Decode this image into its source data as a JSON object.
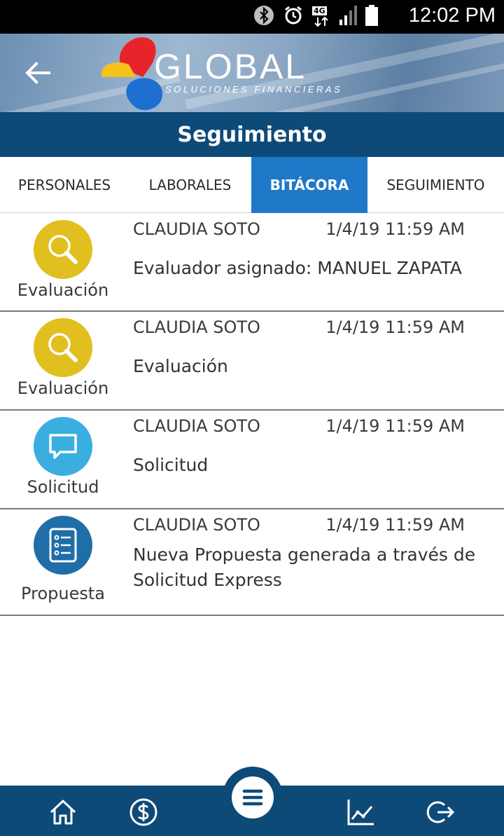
{
  "status_bar": {
    "time": "12:02 PM",
    "network_label": "4G",
    "icons": [
      "bluetooth-icon",
      "alarm-icon",
      "network-4g-icon",
      "signal-icon",
      "battery-icon"
    ]
  },
  "header": {
    "logo_text": "GLOBAL",
    "logo_subtitle": "SOLUCIONES FINANCIERAS",
    "back_icon": "arrow-left-icon"
  },
  "page_title": "Seguimiento",
  "tabs": [
    {
      "label": "PERSONALES",
      "active": false
    },
    {
      "label": "LABORALES",
      "active": false
    },
    {
      "label": "BITÁCORA",
      "active": true
    },
    {
      "label": "SEGUIMIENTO",
      "active": false
    }
  ],
  "entries": [
    {
      "category": "Evaluación",
      "icon": "search-icon",
      "color": "#e0bf1f",
      "user": "CLAUDIA SOTO",
      "timestamp": "1/4/19 11:59 AM",
      "description": "Evaluador asignado: MANUEL ZAPATA"
    },
    {
      "category": "Evaluación",
      "icon": "search-icon",
      "color": "#e0bf1f",
      "user": "CLAUDIA SOTO",
      "timestamp": "1/4/19 11:59 AM",
      "description": "Evaluación"
    },
    {
      "category": "Solicitud",
      "icon": "chat-bubble-icon",
      "color": "#3aaee0",
      "user": "CLAUDIA SOTO",
      "timestamp": "1/4/19 11:59 AM",
      "description": "Solicitud"
    },
    {
      "category": "Propuesta",
      "icon": "checklist-icon",
      "color": "#1f6ea8",
      "user": "CLAUDIA SOTO",
      "timestamp": "1/4/19 11:59 AM",
      "description": "Nueva Propuesta generada a través de Solicitud Express"
    }
  ],
  "bottom_nav": {
    "items": [
      "home-icon",
      "dollar-icon",
      "menu-icon",
      "chart-icon",
      "logout-icon"
    ]
  },
  "colors": {
    "primary_dark": "#0d4a78",
    "tab_active": "#1f78c8"
  }
}
